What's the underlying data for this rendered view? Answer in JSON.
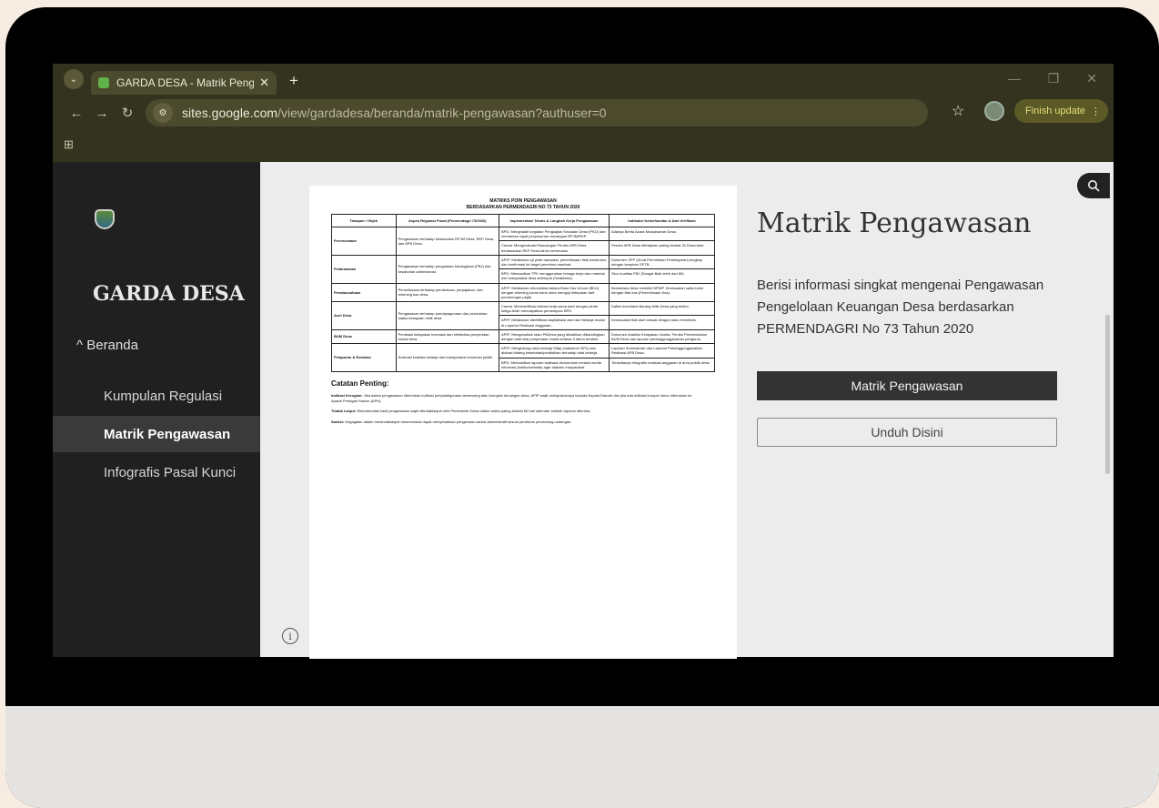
{
  "browser": {
    "tab_title": "GARDA DESA - Matrik Pengawasan",
    "new_tab": "+",
    "url_host": "sites.google.com",
    "url_path": "/view/gardadesa/beranda/matrik-pengawasan?authuser=0",
    "finish_update": "Finish update",
    "apps_icon": "⊞"
  },
  "sidebar": {
    "site_name": "GARDA DESA",
    "home": "Beranda",
    "items": [
      {
        "label": "Kumpulan Regulasi"
      },
      {
        "label": "Matrik Pengawasan",
        "active": true
      },
      {
        "label": "Infografis Pasal Kunci"
      }
    ]
  },
  "page": {
    "heading": "Matrik Pengawasan",
    "description": "Berisi informasi singkat mengenai Pengawasan Pengelolaan Keuangan Desa berdasarkan PERMENDAGRI No 73 Tahun 2020",
    "primary_button": "Matrik Pengawasan",
    "secondary_button": "Unduh Disini"
  },
  "document": {
    "title_line1": "MATRIKS POIN PENGAWASAN",
    "title_line2": "BERDASARKAN PERMENDAGRI NO 73 TAHUN 2020",
    "headers": [
      "Tahapan / Objek",
      "Aspek Regulasi Pusat (Permendagri 73/2020)",
      "Implementasi Teknis & Langkah Kerja Pengawasan",
      "Indikator Keberhasilan & Alat Verifikasi"
    ],
    "rows": [
      {
        "stage": "Perencanaan",
        "aspect": "Pengawasan terhadap kesesuaian RPJM Desa, RKP Desa, dan APB Desa.",
        "impl": "BPD: Menghadiri kegiatan Pengkajian Keadaan Desa (PKD) dan memantau rapat penyusunan rancangan RPJM/RKP.",
        "ind": "Adanya Berita Acara Musyawarah Desa."
      },
      {
        "stage": "",
        "aspect": "",
        "impl": "Camat: Mengevaluasi Rancangan Perdes APB Desa berdasarkan RKP Desa tahun berkenaan.",
        "ind": "Perdes APB Desa ditetapkan paling lambat 31 Desember."
      },
      {
        "stage": "Pelaksanaan",
        "aspect": "Pengawasan terhadap pengadaan barang/jasa (PBJ) dan kepatuhan administrasi.",
        "impl": "APIP: Melakukan uji petik transaksi, pemeriksaan fisik konstruksi, dan konfirmasi ke target penerima manfaat.",
        "ind": "Dokumen SPP (Surat Permintaan Pembayaran) lengkap dengan lampiran SPTB."
      },
      {
        "stage": "",
        "aspect": "",
        "impl": "BPD: Memastikan TPK menggunakan tenaga kerja dan material dari masyarakat desa setempat (Swakelola).",
        "ind": "Skor kualitas PBJ (Sangat Baik lebih dari 80)."
      },
      {
        "stage": "Penatausahaan",
        "aspect": "Pemeriksaan terhadap pembukuan, perpajakan, dan rekening kas desa.",
        "impl": "APIP: Melakukan rekonsiliasi antara Buku Kas Umum (BKU) dengan rekening koran bank serta menguji ketepatan tarif pemotongan pajak.",
        "ind": "Bendahara desa memiliki NPWP. Kesesuaian saldo buku dengan fisik kas (Pemeriksaan Kas)."
      },
      {
        "stage": "Aset Desa",
        "aspect": "Pengawasan terhadap pendayagunaan dan perubahan status kekayaan milik desa.",
        "impl": "Camat: Memverifikasi bahwa kerja sama aset dengan pihak ketiga telah mendapatkan persetujuan BPD.",
        "ind": "Daftar Inventaris Barang Milik Desa yang terkini."
      },
      {
        "stage": "",
        "aspect": "",
        "impl": "APIP: Melakukan identifikasi kapitalisasi aset dari belanja modal di Laporan Realisasi Anggaran.",
        "ind": "Kesesuaian fisik aset sesuai dengan buku inventaris."
      },
      {
        "stage": "BUM Desa",
        "aspect": "Penilaian kelayakan investasi dan efektivitas penyertaan modal desa.",
        "impl": "APIP: Menganalisis rasio PADesa yang dihasilkan dibandingkan dengan total nilai penyertaan modal selama 3 tahun terakhir.",
        "ind": "Dokumen Analisis Kelayakan Usaha. Perdes Pembentukan BUM Desa dan laporan pertanggungjawaban pengurus."
      },
      {
        "stage": "Pelaporan & Evaluasi",
        "aspect": "Evaluasi kualitas belanja dan transparansi informasi publik.",
        "impl": "APIP: Menghitung rasio belanja Sifap (maksimal 30%) dan alokasi bidang kesehatan/pendidikan terhadap total belanja.",
        "ind": "Laporan Semesteran dan Laporan Pertanggungjawaban Realisasi APB Desa."
      },
      {
        "stage": "",
        "aspect": "",
        "impl": "BPD: Memastikan laporan realisasi diumumkan melalui media informasi (baliho/website) agar diakses masyarakat.",
        "ind": "Tersedianya infografis realisasi anggaran di area publik desa."
      }
    ],
    "notes_title": "Catatan Penting:",
    "notes": [
      {
        "label": "Indikasi Kerugian:",
        "text": " Jika dalam pengawasan ditemukan indikasi penyalahgunaan wewenang atau kerugian keuangan desa, APIP wajib melaporkannya kepada Kepala Daerah dan jika ada indikasi korupsi harus diteruskan ke Aparat Penegak Hukum (APH)."
      },
      {
        "label": "Tindak Lanjut:",
        "text": " Rekomendasi hasil pengawasan wajib ditindaklanjuti oleh Pemerintah Desa dalam waktu paling lambat 60 hari kalender setelah laporan diterima."
      },
      {
        "label": "Sanksi:",
        "text": " Kegagalan dalam menindaklanjuti rekomendasi dapat menyebabkan pengenaan sanksi administratif sesuai peraturan perundang-undangan."
      }
    ]
  }
}
